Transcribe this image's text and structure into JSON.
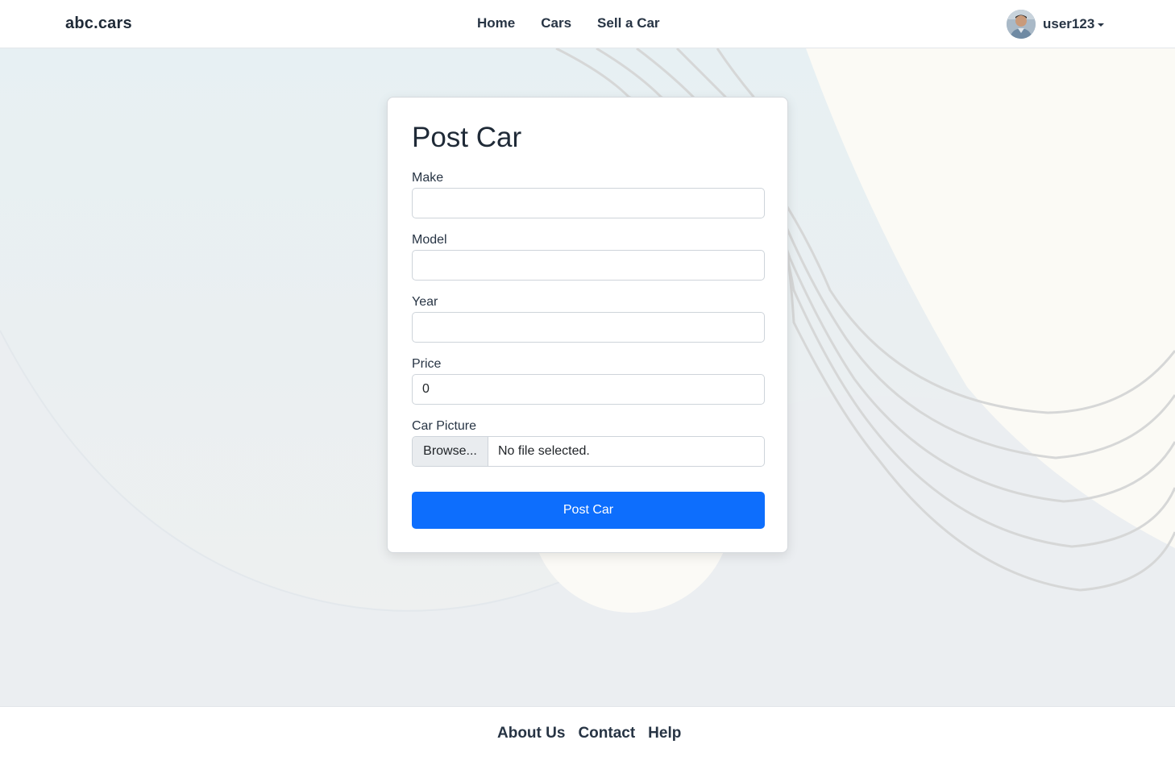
{
  "navbar": {
    "brand": "abc.cars",
    "links": [
      "Home",
      "Cars",
      "Sell a Car"
    ],
    "user": {
      "name": "user123"
    }
  },
  "form": {
    "title": "Post Car",
    "fields": [
      {
        "label": "Make",
        "value": ""
      },
      {
        "label": "Model",
        "value": ""
      },
      {
        "label": "Year",
        "value": ""
      },
      {
        "label": "Price",
        "value": "0"
      }
    ],
    "picture": {
      "label": "Car Picture",
      "browse_label": "Browse...",
      "status": "No file selected."
    },
    "submit_label": "Post Car"
  },
  "footer": {
    "links": [
      "About Us",
      "Contact",
      "Help"
    ]
  },
  "colors": {
    "primary": "#0d6efd",
    "text": "#212b36"
  }
}
